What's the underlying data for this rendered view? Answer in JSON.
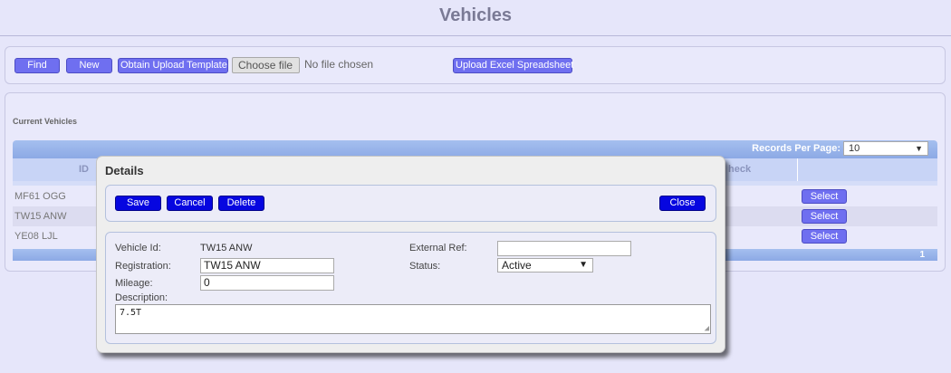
{
  "page": {
    "title": "Vehicles"
  },
  "toolbar": {
    "find_label": "Find",
    "new_label": "New",
    "template_label": "Obtain Upload Template",
    "choose_file_label": "Choose file",
    "no_file_text": "No file chosen",
    "upload_label": "Upload Excel Spreadsheet"
  },
  "grid": {
    "section_title": "Current Vehicles",
    "records_per_page_label": "Records Per Page:",
    "records_per_page_value": "10",
    "columns": {
      "id": "ID",
      "check": "heck"
    },
    "rows": [
      {
        "registration": "MF61 OGG",
        "select_label": "Select"
      },
      {
        "registration": "TW15 ANW",
        "select_label": "Select"
      },
      {
        "registration": "YE08 LJL",
        "select_label": "Select"
      }
    ],
    "page_number": "1"
  },
  "dialog": {
    "title": "Details",
    "buttons": {
      "save": "Save",
      "cancel": "Cancel",
      "delete": "Delete",
      "close": "Close"
    },
    "fields": {
      "vehicle_id_label": "Vehicle Id:",
      "vehicle_id_value": "TW15 ANW",
      "registration_label": "Registration:",
      "registration_value": "TW15 ANW",
      "mileage_label": "Mileage:",
      "mileage_value": "0",
      "description_label": "Description:",
      "description_value": "7.5T",
      "external_ref_label": "External Ref:",
      "external_ref_value": "",
      "status_label": "Status:",
      "status_value": "Active"
    }
  },
  "colors": {
    "background": "#e6e6fa",
    "accent_button": "#6f6ff0",
    "dialog_button": "#0606e0",
    "grid_header": "#8ca9e5"
  },
  "icons": {
    "dropdown": "chevron-down-icon",
    "resize": "resize-handle-icon"
  }
}
